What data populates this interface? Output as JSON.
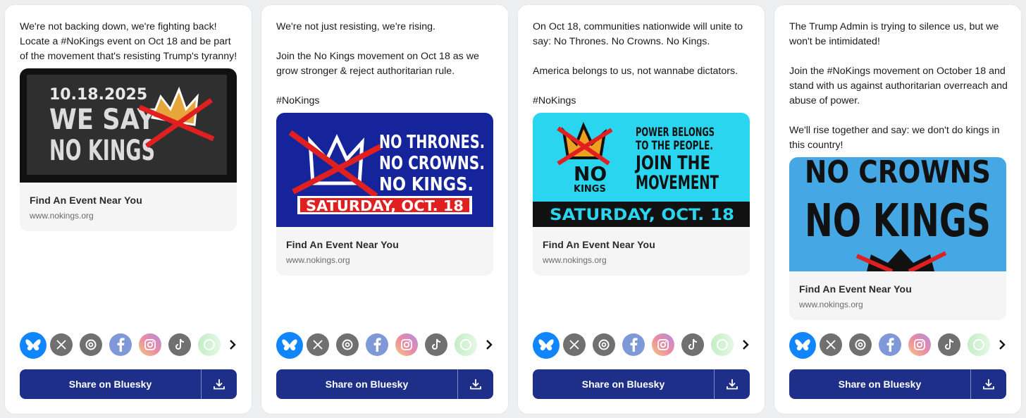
{
  "colors": {
    "share_button": "#1e2f8a",
    "bluesky": "#1185fe",
    "card_bg": "#ffffff",
    "page_bg": "#eeeff1"
  },
  "share_icons": [
    "bluesky-icon",
    "x-icon",
    "threads-icon",
    "facebook-icon",
    "instagram-icon",
    "tiktok-icon",
    "whatsapp-icon",
    "chevron-right-icon"
  ],
  "cards": [
    {
      "message": "We're not backing down, we're fighting back!\nLocate a #NoKings event on Oct 18 and be part of the movement that's resisting Trump's tyranny!",
      "image": {
        "date": "10.18.2025",
        "line1": "WE SAY",
        "line2": "NO KINGS"
      },
      "link_title": "Find An Event Near You",
      "link_url": "www.nokings.org",
      "share_label": "Share on Bluesky"
    },
    {
      "message": "We're not just resisting, we're rising.\n\nJoin the No Kings movement on Oct 18 as we grow stronger & reject authoritarian rule.\n\n#NoKings",
      "image": {
        "line1": "NO THRONES.",
        "line2": "NO CROWNS.",
        "line3": "NO KINGS.",
        "banner": "SATURDAY, OCT. 18"
      },
      "link_title": "Find An Event Near You",
      "link_url": "www.nokings.org",
      "share_label": "Share on Bluesky"
    },
    {
      "message": "On Oct 18, communities nationwide will unite to say: No Thrones. No Crowns. No Kings.\n\nAmerica belongs to us, not wannabe dictators.\n\n#NoKings",
      "image": {
        "logo_no": "NO",
        "logo_kings": "KINGS",
        "line1": "POWER BELONGS",
        "line2": "TO THE PEOPLE.",
        "line3": "JOIN THE",
        "line4": "MOVEMENT",
        "banner": "SATURDAY, OCT. 18"
      },
      "link_title": "Find An Event Near You",
      "link_url": "www.nokings.org",
      "share_label": "Share on Bluesky"
    },
    {
      "message": "The Trump Admin is trying to silence us, but we won't be intimidated!\n\nJoin the #NoKings movement on October 18 and stand with us against authoritarian overreach and abuse of power.\n\nWe'll rise together and say: we don't do kings in this country!",
      "image": {
        "line1": "NO CROWNS",
        "line2": "NO KINGS"
      },
      "link_title": "Find An Event Near You",
      "link_url": "www.nokings.org",
      "share_label": "Share on Bluesky"
    }
  ]
}
